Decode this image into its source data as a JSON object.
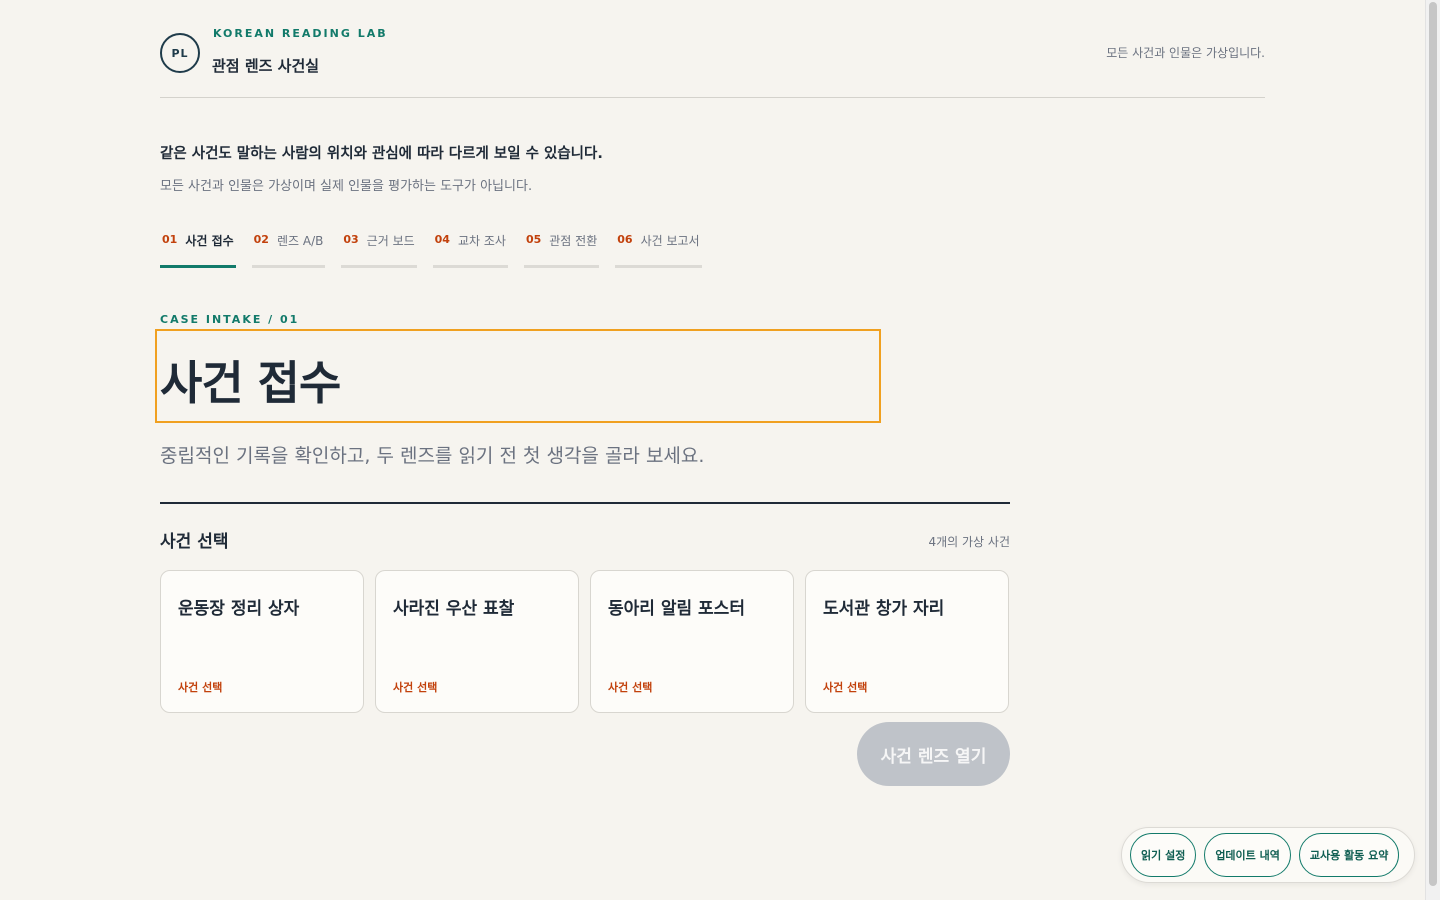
{
  "header": {
    "logo": "PL",
    "eyebrow": "KOREAN READING LAB",
    "title": "관점 렌즈 사건실",
    "note": "모든 사건과 인물은 가상입니다."
  },
  "intro": {
    "lead": "같은 사건도 말하는 사람의 위치와 관심에 따라 다르게 보일 수 있습니다.",
    "sub": "모든 사건과 인물은 가상이며 실제 인물을 평가하는 도구가 아닙니다."
  },
  "steps": [
    {
      "num": "01",
      "label": "사건 접수",
      "active": true
    },
    {
      "num": "02",
      "label": "렌즈 A/B",
      "active": false
    },
    {
      "num": "03",
      "label": "근거 보드",
      "active": false
    },
    {
      "num": "04",
      "label": "교차 조사",
      "active": false
    },
    {
      "num": "05",
      "label": "관점 전환",
      "active": false
    },
    {
      "num": "06",
      "label": "사건 보고서",
      "active": false
    }
  ],
  "intake": {
    "eyebrow": "CASE INTAKE / 01",
    "title": "사건 접수",
    "description": "중립적인 기록을 확인하고, 두 렌즈를 읽기 전 첫 생각을 골라 보세요."
  },
  "cases": {
    "heading": "사건 선택",
    "count": "4개의 가상 사건",
    "items": [
      {
        "title": "운동장 정리 상자",
        "action": "사건 선택"
      },
      {
        "title": "사라진 우산 표찰",
        "action": "사건 선택"
      },
      {
        "title": "동아리 알림 포스터",
        "action": "사건 선택"
      },
      {
        "title": "도서관 창가 자리",
        "action": "사건 선택"
      }
    ],
    "open_button": "사건 렌즈 열기"
  },
  "toolbar": {
    "reading_settings": "읽기 설정",
    "updates": "업데이트 내역",
    "teacher_summary": "교사용 활동 요약"
  },
  "colors": {
    "accent": "#127a6a",
    "step_number": "#c2410c",
    "highlight_border": "#f0a020",
    "background": "#f6f4ef",
    "disabled_button": "#bfc3c9"
  }
}
